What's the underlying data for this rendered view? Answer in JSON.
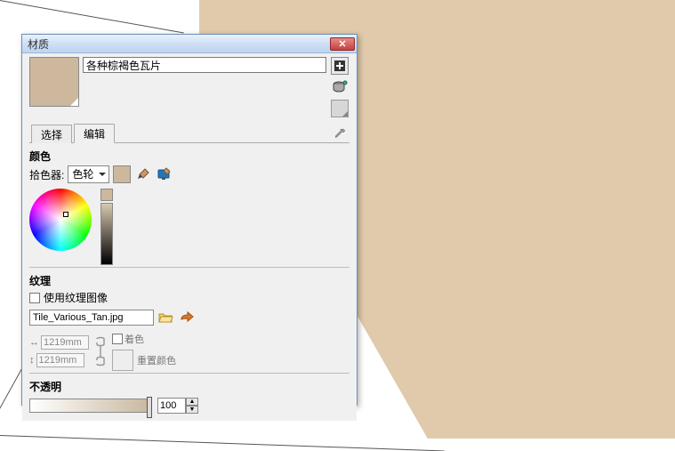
{
  "window": {
    "title": "材质"
  },
  "material": {
    "name": "各种棕褐色瓦片",
    "swatch_hex": "#cdb89e"
  },
  "tabs": {
    "select": "选择",
    "edit": "编辑",
    "active": "edit"
  },
  "color": {
    "section": "颜色",
    "picker_label": "拾色器:",
    "picker_mode": "色轮"
  },
  "texture": {
    "section": "纹理",
    "use_image": "使用纹理图像",
    "filename": "Tile_Various_Tan.jpg",
    "width": "1219mm",
    "height": "1219mm",
    "colorize": "着色",
    "reset_color": "重置颜色"
  },
  "opacity": {
    "section": "不透明",
    "value": "100"
  },
  "icons": {
    "create": "create-material-icon",
    "default": "set-default-icon"
  }
}
